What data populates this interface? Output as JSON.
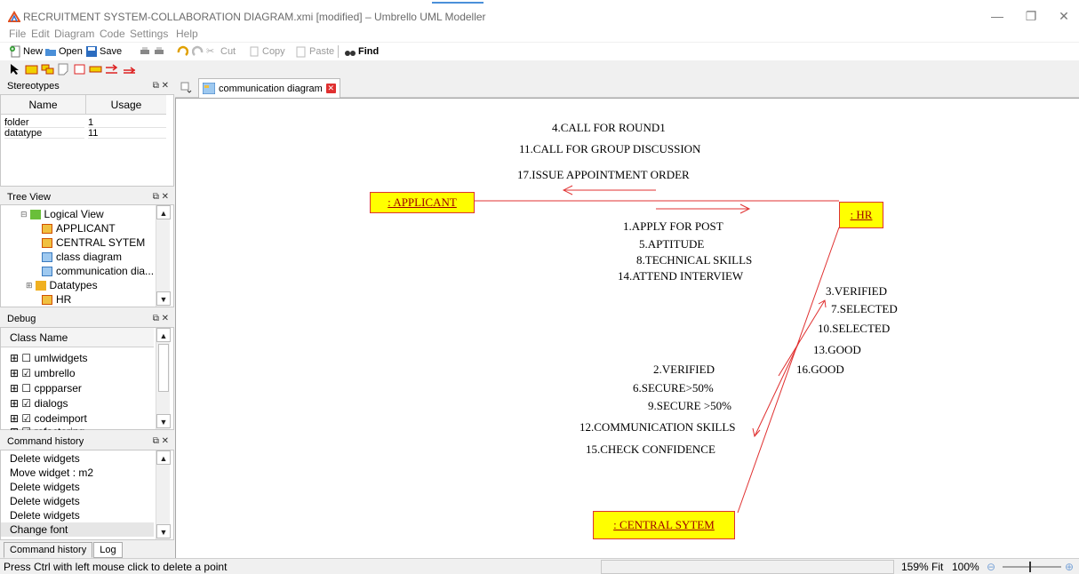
{
  "window": {
    "title": "RECRUITMENT SYSTEM-COLLABORATION DIAGRAM.xmi [modified] – Umbrello UML Modeller",
    "minimize": "—",
    "restore": "❐",
    "close": "✕"
  },
  "menu": [
    "File",
    "Edit",
    "Diagram",
    "Code",
    "Settings",
    "Help"
  ],
  "toolbar": {
    "new": "New",
    "open": "Open",
    "save": "Save",
    "cut": "Cut",
    "copy": "Copy",
    "paste": "Paste",
    "find": "Find"
  },
  "stereotypes": {
    "title": "Stereotypes",
    "columns": [
      "Name",
      "Usage"
    ],
    "rows": [
      {
        "name": "folder",
        "usage": "1"
      },
      {
        "name": "datatype",
        "usage": "11"
      }
    ]
  },
  "tree_view": {
    "title": "Tree View",
    "items": [
      {
        "label": "Logical View",
        "icon": "folder-icon"
      },
      {
        "label": "APPLICANT",
        "icon": "class-icon"
      },
      {
        "label": "CENTRAL SYTEM",
        "icon": "class-icon"
      },
      {
        "label": "class diagram",
        "icon": "diagram-icon"
      },
      {
        "label": "communication dia...",
        "icon": "diagram-icon"
      },
      {
        "label": "Datatypes",
        "icon": "folder-icon"
      },
      {
        "label": "HR",
        "icon": "class-icon"
      }
    ]
  },
  "debug": {
    "title": "Debug",
    "header": "Class Name",
    "items": [
      {
        "label": "umlwidgets",
        "checked": false
      },
      {
        "label": "umbrello",
        "checked": true
      },
      {
        "label": "cppparser",
        "checked": false
      },
      {
        "label": "dialogs",
        "checked": true
      },
      {
        "label": "codeimport",
        "checked": true
      },
      {
        "label": "refactoring",
        "checked": true
      }
    ]
  },
  "command_history": {
    "title": "Command history",
    "items": [
      "Delete widgets",
      "Move widget : m2",
      "Delete widgets",
      "Delete widgets",
      "Delete widgets",
      "Change font"
    ],
    "tabs": [
      "Command history",
      "Log"
    ]
  },
  "diagram_tab": {
    "label": "communication diagram"
  },
  "diagram": {
    "nodes": {
      "applicant": ": APPLICANT",
      "hr": ": HR",
      "central": ": CENTRAL SYTEM"
    },
    "messages_to_applicant": [
      "4.CALL FOR ROUND1",
      "11.CALL FOR GROUP DISCUSSION",
      "17.ISSUE APPOINTMENT ORDER"
    ],
    "messages_to_hr": [
      "1.APPLY FOR POST",
      "5.APTITUDE",
      "8.TECHNICAL SKILLS",
      "14.ATTEND INTERVIEW"
    ],
    "messages_to_hr_from_central": [
      "3.VERIFIED",
      "7.SELECTED",
      "10.SELECTED",
      "13.GOOD",
      "16.GOOD"
    ],
    "messages_to_central": [
      "2.VERIFIED",
      "6.SECURE>50%",
      "9.SECURE >50%",
      "12.COMMUNICATION SKILLS",
      "15.CHECK CONFIDENCE"
    ],
    "line_color": "#e03030",
    "node_fill": "#ffff00"
  },
  "status": {
    "message": "Press Ctrl with left mouse click to delete a point",
    "zoom": "159%",
    "fit": "Fit",
    "hundred": "100%"
  }
}
